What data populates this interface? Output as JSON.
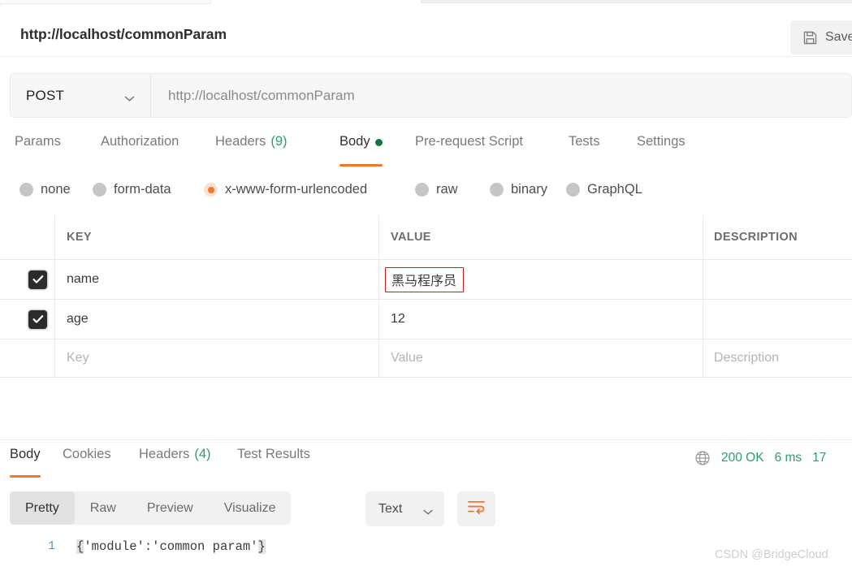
{
  "request": {
    "title": "http://localhost/commonParam",
    "save_label": "Save",
    "save_icon": "floppy-disk-icon",
    "method": "POST",
    "method_chevron": "chevron-down-icon",
    "url": "http://localhost/commonParam",
    "tabs": [
      {
        "label": "Params",
        "count": "",
        "active": false,
        "dot": false
      },
      {
        "label": "Authorization",
        "count": "",
        "active": false,
        "dot": false
      },
      {
        "label": "Headers",
        "count": "(9)",
        "active": false,
        "dot": false
      },
      {
        "label": "Body",
        "count": "",
        "active": true,
        "dot": true
      },
      {
        "label": "Pre-request Script",
        "count": "",
        "active": false,
        "dot": false
      },
      {
        "label": "Tests",
        "count": "",
        "active": false,
        "dot": false
      },
      {
        "label": "Settings",
        "count": "",
        "active": false,
        "dot": false
      }
    ],
    "body_types": [
      {
        "label": "none",
        "selected": false
      },
      {
        "label": "form-data",
        "selected": false
      },
      {
        "label": "x-www-form-urlencoded",
        "selected": true
      },
      {
        "label": "raw",
        "selected": false
      },
      {
        "label": "binary",
        "selected": false
      },
      {
        "label": "GraphQL",
        "selected": false
      }
    ]
  },
  "params_table": {
    "columns": [
      "KEY",
      "VALUE",
      "DESCRIPTION"
    ],
    "rows": [
      {
        "checked": true,
        "key": "name",
        "value": "黑马程序员",
        "description": "",
        "value_highlighted": true
      },
      {
        "checked": true,
        "key": "age",
        "value": "12",
        "description": "",
        "value_highlighted": false
      }
    ],
    "placeholder_row": {
      "key": "Key",
      "value": "Value",
      "description": "Description"
    }
  },
  "response": {
    "tabs": [
      {
        "label": "Body",
        "count": "",
        "active": true
      },
      {
        "label": "Cookies",
        "count": "",
        "active": false
      },
      {
        "label": "Headers",
        "count": "(4)",
        "active": false
      },
      {
        "label": "Test Results",
        "count": "",
        "active": false
      }
    ],
    "status_icon": "globe-icon",
    "status_code": "200 OK",
    "time": "6 ms",
    "size": "17",
    "view_modes": [
      {
        "label": "Pretty",
        "active": true
      },
      {
        "label": "Raw",
        "active": false
      },
      {
        "label": "Preview",
        "active": false
      },
      {
        "label": "Visualize",
        "active": false
      }
    ],
    "format": "Text",
    "format_chevron": "chevron-down-icon",
    "wrap_icon": "wrap-text-icon",
    "line_number": "1",
    "body_text": "{'module':'common param'}"
  },
  "watermark": "CSDN @BridgeCloud",
  "colors": {
    "accent": "#f2762e",
    "success": "#2f9e6e",
    "dot": "#14753e",
    "highlight": "#d71b1b"
  }
}
